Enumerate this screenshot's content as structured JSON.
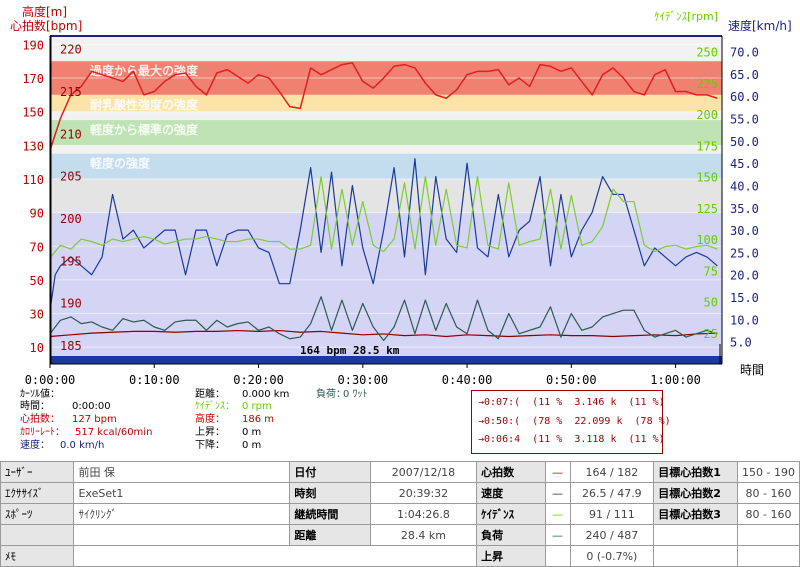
{
  "chart_data": {
    "type": "line",
    "xlabel": "時間",
    "x_ticks": [
      "0:00:00",
      "0:10:00",
      "0:20:00",
      "0:30:00",
      "0:40:00",
      "0:50:00",
      "1:00:00"
    ],
    "x_range_min": [
      0,
      64.45
    ],
    "axes": {
      "heart_rate": {
        "label": "心拍数[bpm]",
        "color": "#c00000",
        "range": [
          0,
          195
        ],
        "ticks": [
          10,
          30,
          50,
          70,
          90,
          110,
          130,
          150,
          170,
          190
        ]
      },
      "altitude": {
        "label": "高度[m]",
        "color": "#c00000",
        "range": [
          182.75,
          221.5
        ],
        "ticks": [
          185,
          190,
          195,
          200,
          205,
          210,
          215,
          220
        ]
      },
      "cadence": {
        "label": "ｹｲﾃﾞﾝｽ[rpm]",
        "color": "#66cc00",
        "range": [
          0,
          262.5
        ],
        "ticks": [
          25,
          50,
          75,
          100,
          125,
          150,
          175,
          200,
          225,
          250
        ]
      },
      "speed": {
        "label": "速度[km/h]",
        "color": "#1a237e",
        "range": [
          0,
          73.5
        ],
        "ticks": [
          "5.0",
          "10.0",
          "15.0",
          "20.0",
          "25.0",
          "30.0",
          "35.0",
          "40.0",
          "45.0",
          "50.0",
          "55.0",
          "60.0",
          "65.0",
          "70.0"
        ]
      }
    },
    "zones": [
      {
        "label": "過度から最大の強度",
        "from": 160,
        "to": 180,
        "color": "#f08070"
      },
      {
        "label": "耐乳酸性強度の強度",
        "from": 150,
        "to": 160,
        "color": "#fce4a8"
      },
      {
        "label": "軽度から標準の強度",
        "from": 130,
        "to": 145,
        "color": "#bfe3b4"
      },
      {
        "label": "軽度の強度",
        "from": 110,
        "to": 125,
        "color": "#c3dcee"
      },
      {
        "label": "",
        "from": 90,
        "to": 110,
        "color": "#e4e4e4"
      },
      {
        "label": "",
        "from": 0,
        "to": 90,
        "color": "#d4d4f4"
      }
    ],
    "series": [
      {
        "key": "heart_rate",
        "axis": "heart_rate",
        "color": "#e02020",
        "x": [
          0,
          1,
          2,
          3,
          4,
          5,
          6,
          7,
          8,
          9,
          10,
          11,
          12,
          13,
          14,
          15,
          16,
          17,
          18,
          19,
          20,
          21,
          22,
          23,
          24,
          25,
          26,
          27,
          28,
          29,
          30,
          31,
          32,
          33,
          34,
          35,
          36,
          37,
          38,
          39,
          40,
          41,
          42,
          43,
          44,
          45,
          46,
          47,
          48,
          49,
          50,
          51,
          52,
          53,
          54,
          55,
          56,
          57,
          58,
          59,
          60,
          61,
          62,
          63,
          64
        ],
        "values": [
          127,
          146,
          160,
          165,
          174,
          172,
          170,
          168,
          174,
          160,
          162,
          168,
          172,
          173,
          165,
          160,
          173,
          175,
          171,
          167,
          172,
          170,
          162,
          153,
          152,
          176,
          172,
          175,
          178,
          179,
          168,
          164,
          170,
          177,
          178,
          176,
          167,
          160,
          158,
          163,
          172,
          174,
          174,
          175,
          166,
          170,
          165,
          178,
          177,
          174,
          176,
          168,
          160,
          172,
          176,
          170,
          162,
          160,
          172,
          175,
          162,
          162,
          160,
          160,
          158
        ]
      },
      {
        "key": "speed",
        "axis": "speed",
        "color": "#1a3a9c",
        "x": [
          0,
          0.5,
          1,
          2,
          3,
          4,
          5,
          6,
          7,
          8,
          9,
          10,
          11,
          12,
          13,
          14,
          15,
          16,
          17,
          18,
          19,
          20,
          21,
          22,
          23,
          24,
          25,
          26,
          27,
          28,
          29,
          30,
          31,
          32,
          33,
          34,
          35,
          36,
          37,
          38,
          39,
          40,
          41,
          42,
          43,
          44,
          45,
          46,
          47,
          48,
          49,
          50,
          51,
          52,
          53,
          54,
          55,
          56,
          57,
          58,
          59,
          60,
          61,
          62,
          63,
          64
        ],
        "values": [
          12,
          20,
          22,
          24,
          22,
          20,
          24,
          38,
          28,
          30,
          26,
          28,
          30,
          30,
          20,
          30,
          30,
          22,
          29,
          30,
          30,
          26,
          25,
          18,
          18,
          30,
          44,
          25,
          43,
          22,
          40,
          26,
          18,
          30,
          44,
          24,
          46,
          20,
          42,
          28,
          25,
          45,
          26,
          24,
          38,
          24,
          30,
          32,
          42,
          22,
          38,
          24,
          30,
          34,
          42,
          38,
          38,
          30,
          22,
          26,
          24,
          22,
          24,
          25,
          24,
          22
        ]
      },
      {
        "key": "cadence",
        "axis": "cadence",
        "color": "#7ccc33",
        "x": [
          0,
          1,
          2,
          3,
          4,
          5,
          6,
          7,
          8,
          9,
          10,
          11,
          12,
          13,
          14,
          15,
          16,
          17,
          18,
          19,
          20,
          21,
          22,
          23,
          24,
          25,
          26,
          27,
          28,
          29,
          30,
          31,
          32,
          33,
          34,
          35,
          36,
          37,
          38,
          39,
          40,
          41,
          42,
          43,
          44,
          45,
          46,
          47,
          48,
          49,
          50,
          51,
          52,
          53,
          54,
          55,
          56,
          57,
          58,
          59,
          60,
          61,
          62,
          63,
          64
        ],
        "values": [
          85,
          95,
          92,
          100,
          98,
          95,
          100,
          98,
          100,
          102,
          100,
          96,
          98,
          100,
          100,
          102,
          100,
          98,
          98,
          100,
          100,
          98,
          98,
          92,
          92,
          95,
          150,
          92,
          140,
          95,
          130,
          95,
          90,
          100,
          145,
          92,
          150,
          95,
          140,
          95,
          93,
          150,
          95,
          92,
          145,
          95,
          98,
          100,
          140,
          92,
          135,
          95,
          98,
          110,
          140,
          130,
          130,
          95,
          90,
          94,
          95,
          92,
          94,
          95,
          92
        ]
      },
      {
        "key": "altitude",
        "axis": "altitude",
        "color": "#8b0000",
        "x": [
          0,
          2,
          4,
          6,
          8,
          10,
          12,
          14,
          16,
          18,
          20,
          22,
          24,
          26,
          28,
          30,
          32,
          34,
          36,
          38,
          40,
          42,
          44,
          46,
          48,
          50,
          52,
          54,
          56,
          58,
          60,
          62,
          64
        ],
        "values": [
          186,
          186.2,
          186.4,
          186.5,
          186.6,
          186.6,
          186.5,
          186.6,
          186.6,
          186.7,
          186.6,
          186.7,
          186.5,
          186.6,
          186.4,
          186.2,
          186.3,
          186.1,
          186.2,
          186,
          186.2,
          186.1,
          186,
          186.1,
          186.2,
          186.1,
          186.1,
          186,
          186.1,
          186.2,
          186.1,
          186.3,
          186.4
        ]
      },
      {
        "key": "power",
        "axis": "heart_rate",
        "color": "#2d5a52",
        "x": [
          0,
          1,
          2,
          3,
          4,
          5,
          6,
          7,
          8,
          9,
          10,
          11,
          12,
          13,
          14,
          15,
          16,
          17,
          18,
          19,
          20,
          21,
          22,
          23,
          24,
          25,
          26,
          27,
          28,
          29,
          30,
          31,
          32,
          33,
          34,
          35,
          36,
          37,
          38,
          39,
          40,
          41,
          42,
          43,
          44,
          45,
          46,
          47,
          48,
          49,
          50,
          51,
          52,
          53,
          54,
          55,
          56,
          57,
          58,
          59,
          60,
          61,
          62,
          63,
          64
        ],
        "values": [
          18,
          26,
          28,
          24,
          25,
          22,
          20,
          27,
          25,
          26,
          22,
          20,
          25,
          26,
          26,
          20,
          26,
          22,
          24,
          25,
          20,
          22,
          18,
          15,
          16,
          24,
          40,
          20,
          38,
          20,
          36,
          22,
          14,
          22,
          38,
          18,
          38,
          20,
          36,
          22,
          18,
          38,
          20,
          15,
          30,
          18,
          20,
          22,
          34,
          16,
          30,
          20,
          22,
          28,
          30,
          32,
          32,
          20,
          16,
          18,
          20,
          16,
          18,
          20,
          18
        ]
      }
    ],
    "overlay_text": "164 bpm 28.5 km"
  },
  "cursor": {
    "rows": [
      {
        "label": "ｶｰｿﾙ値：",
        "value": ""
      },
      {
        "label": "時間：",
        "value": "0:00:00"
      },
      {
        "label": "心拍数：",
        "value": "127 bpm"
      },
      {
        "label": "ｶﾛﾘｰﾚｰﾄ：",
        "value": "517 kcal/60min"
      },
      {
        "label": "速度：",
        "value": "0.0 km/h"
      }
    ],
    "mid": [
      {
        "label": "距離：",
        "value": "0.000 km"
      },
      {
        "label": "ｹｲﾃﾞﾝｽ：",
        "value": "0 rpm"
      },
      {
        "label": "高度：",
        "value": "186 m"
      },
      {
        "label": "上昇：",
        "value": "0 m"
      },
      {
        "label": "下降：",
        "value": "0 m"
      }
    ],
    "load": {
      "label": "負荷：",
      "value": "0 ﾜｯﾄ"
    }
  },
  "laps": [
    "→0:07:(  (11 %  3.146 k  (11 %)",
    "→0:50:(  (78 %  22.099 k  (78 %)",
    "→0:06:4  (11 %  3.118 k  (11 %)"
  ],
  "summary": {
    "user_label": "ﾕｰｻﾞｰ",
    "user": "前田 保",
    "exercise_label": "ｴｸｻｻｲｽﾞ",
    "exercise": "ExeSet1",
    "sport_label": "ｽﾎﾟｰﾂ",
    "sport": "ｻｲｸﾘﾝｸﾞ",
    "memo_label": "ﾒﾓ",
    "date_label": "日付",
    "date": "2007/12/18",
    "time_label": "時刻",
    "time": "20:39:32",
    "duration_label": "継続時間",
    "duration": "1:04:26.8",
    "distance_label": "距離",
    "distance": "28.4 km",
    "hr_label": "心拍数",
    "hr": "164 / 182",
    "speed_label": "速度",
    "speed": "26.5 / 47.9",
    "cadence_label": "ｹｲﾃﾞﾝｽ",
    "cadence": "91 / 111",
    "load_label": "負荷",
    "load": "240 / 487",
    "ascent_label": "上昇",
    "ascent": "0 (-0.7%)",
    "target1_label": "目標心拍数1",
    "target1": "150 - 190",
    "target2_label": "目標心拍数2",
    "target2": "80 - 160",
    "target3_label": "目標心拍数3",
    "target3": "80 - 160"
  },
  "colors": {
    "hr": "#c00000",
    "speed": "#1a237e",
    "cadence": "#66cc00",
    "power": "#2d5a52"
  }
}
